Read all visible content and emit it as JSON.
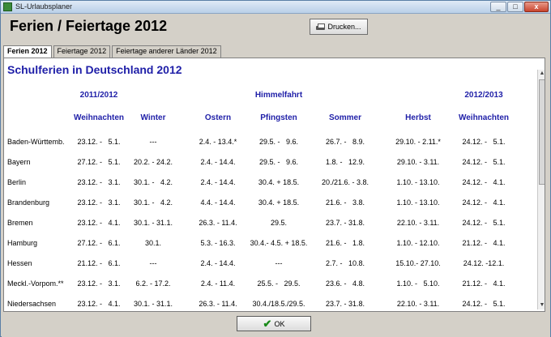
{
  "window": {
    "title": "SL-Urlaubsplaner"
  },
  "header": {
    "title": "Ferien / Feiertage 2012",
    "print_label": "Drucken..."
  },
  "tabs": [
    {
      "label": "Ferien 2012"
    },
    {
      "label": "Feiertage 2012"
    },
    {
      "label": "Feiertage anderer Länder 2012"
    }
  ],
  "table": {
    "heading": "Schulferien  in Deutschland 2012",
    "group_labels": [
      "2011/2012",
      "Himmelfahrt",
      "2012/2013"
    ],
    "columns": [
      "Weihnachten",
      "Winter",
      "Ostern",
      "Pfingsten",
      "Sommer",
      "Herbst",
      "Weihnachten"
    ],
    "rows": [
      {
        "state": "Baden-Württemb.",
        "cells": [
          "23.12. -   5.1.",
          "---",
          "2.4. - 13.4.*",
          "29.5. -   9.6.",
          "26.7. -   8.9.",
          "29.10. - 2.11.*",
          "24.12. -   5.1."
        ]
      },
      {
        "state": "Bayern",
        "cells": [
          "27.12. -   5.1.",
          "20.2. - 24.2.",
          "2.4. - 14.4.",
          "29.5. -   9.6.",
          "1.8. -   12.9.",
          "29.10. - 3.11.",
          "24.12. -   5.1."
        ]
      },
      {
        "state": "Berlin",
        "cells": [
          "23.12. -   3.1.",
          "30.1. -   4.2.",
          "2.4. - 14.4.",
          "30.4. + 18.5.",
          "20./21.6. - 3.8.",
          "1.10. - 13.10.",
          "24.12. -   4.1."
        ]
      },
      {
        "state": "Brandenburg",
        "cells": [
          "23.12. -   3.1.",
          "30.1. -   4.2.",
          "4.4. - 14.4.",
          "30.4. + 18.5.",
          "21.6. -   3.8.",
          "1.10. - 13.10.",
          "24.12. -   4.1."
        ]
      },
      {
        "state": "Bremen",
        "cells": [
          "23.12. -   4.1.",
          "30.1. - 31.1.",
          "26.3. - 11.4.",
          "29.5.",
          "23.7. - 31.8.",
          "22.10. - 3.11.",
          "24.12. -   5.1."
        ]
      },
      {
        "state": "Hamburg",
        "cells": [
          "27.12. -   6.1.",
          "30.1.",
          "5.3. - 16.3.",
          "30.4.- 4.5. + 18.5.",
          "21.6. -   1.8.",
          "1.10. - 12.10.",
          "21.12. -   4.1."
        ]
      },
      {
        "state": "Hessen",
        "cells": [
          "21.12. -   6.1.",
          "---",
          "2.4. - 14.4.",
          "---",
          "2.7. -   10.8.",
          "15.10.- 27.10.",
          "24.12. -12.1."
        ]
      },
      {
        "state": "Meckl.-Vorpom.**",
        "cells": [
          "23.12. -   3.1.",
          "6.2. - 17.2.",
          "2.4. - 11.4.",
          "25.5. -   29.5.",
          "23.6. -   4.8.",
          "1.10. -   5.10.",
          "21.12. -   4.1."
        ]
      },
      {
        "state": "Niedersachsen",
        "cells": [
          "23.12. -   4.1.",
          "30.1. - 31.1.",
          "26.3. - 11.4.",
          "30.4./18.5./29.5.",
          "23.7. - 31.8.",
          "22.10. - 3.11.",
          "24.12. -   5.1."
        ]
      }
    ]
  },
  "footer": {
    "ok_label": "OK"
  }
}
